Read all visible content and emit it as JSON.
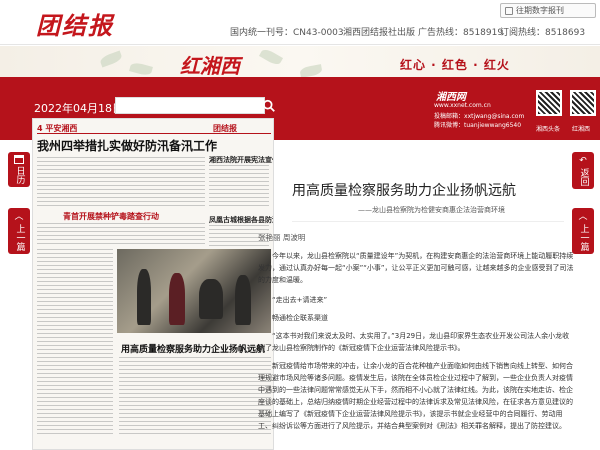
{
  "header": {
    "logo": "团结报",
    "archive_label": "往期数字报刊",
    "cn": "国内统一刊号：CN43-0003",
    "publisher": "湘西团结报社出版",
    "ad_phone": "广告热线：8518919",
    "sub_phone": "订阅热线：8518693"
  },
  "banner": {
    "title": "红湘西",
    "slogan": "红心 · 红色 · 红火"
  },
  "toolbar": {
    "date": "2022年04月18日",
    "search_placeholder": ""
  },
  "banner_right": {
    "site": "湘西网",
    "url": "www.xxnet.com.cn",
    "email_label": "投稿邮箱：",
    "email": "xxtjwang@sina.com",
    "wechat_label": "腾讯微博：",
    "wechat": "tuanjiewwang6540",
    "qr1_label": "湘西头条",
    "qr2_label": "红湘西"
  },
  "left_nav": {
    "history": "日历",
    "up": "上一篇"
  },
  "right_nav": {
    "back": "返回",
    "up": "上一篇"
  },
  "newspaper": {
    "page_label": "4  平安湘西",
    "edition_label": "团结报",
    "headline": "我州四举措扎实做好防汛备汛工作",
    "sub1": "湘西法院开展宪法宣传",
    "sub2": "青首开展禁种铲毒踏查行动",
    "sub3": "凤凰古城根据各县防汛处置情况",
    "bottom_title": "用高质量检察服务助力企业扬帆远航"
  },
  "article": {
    "title": "用高质量检察服务助力企业扬帆远航",
    "subtitle": "——龙山县检察院为检健安商惠企法治营商环境",
    "author": "张艳丽 周波明",
    "p1": "今年以来，龙山县检察院以“质量建设年”为契机，在构建安商惠企的法治营商环境上能动履职持续发力，通过认真办好每一起“小案”“小事”，让公平正义更加可触可感，让越来越多的企业感受到了司法的力度和温暖。",
    "p2": "“走出去+请进来”",
    "p3": "畅通检企联系渠道",
    "p4": "“这本书对我们来说太及时、太实用了。”3月29日，龙山县印家界生态农业开发公司法人余小龙收到了龙山县检察院制作的《新冠疫情下企业运营法律风险提示书》。",
    "p5": "新冠疫情给市场带来的冲击，让余小龙的百合花种植产业面临如何由线下销售向线上转型、如何合理规避市场风险等诸多问题。疫情发生后，该院在全体员检企业过程中了解到，一些企业负责人对疫情中遇到的一些法律问题常常感觉无从下手，然而相不小心就了法律红线。为此，该院在实地走访、检企座谈的基础上，总结归纳疫情时期企业经营过程中的法律诉求及常见法律风险，在征求各方意见建议的基础上编写了《新冠疫情下企业运营法律风险提示书》，该提示书就企业经营中的合同履行、劳动用工、纠纷诉讼等方面进行了风险提示，并结合典型案例对《刑法》相关罪名解释，提出了防控建议。"
  }
}
